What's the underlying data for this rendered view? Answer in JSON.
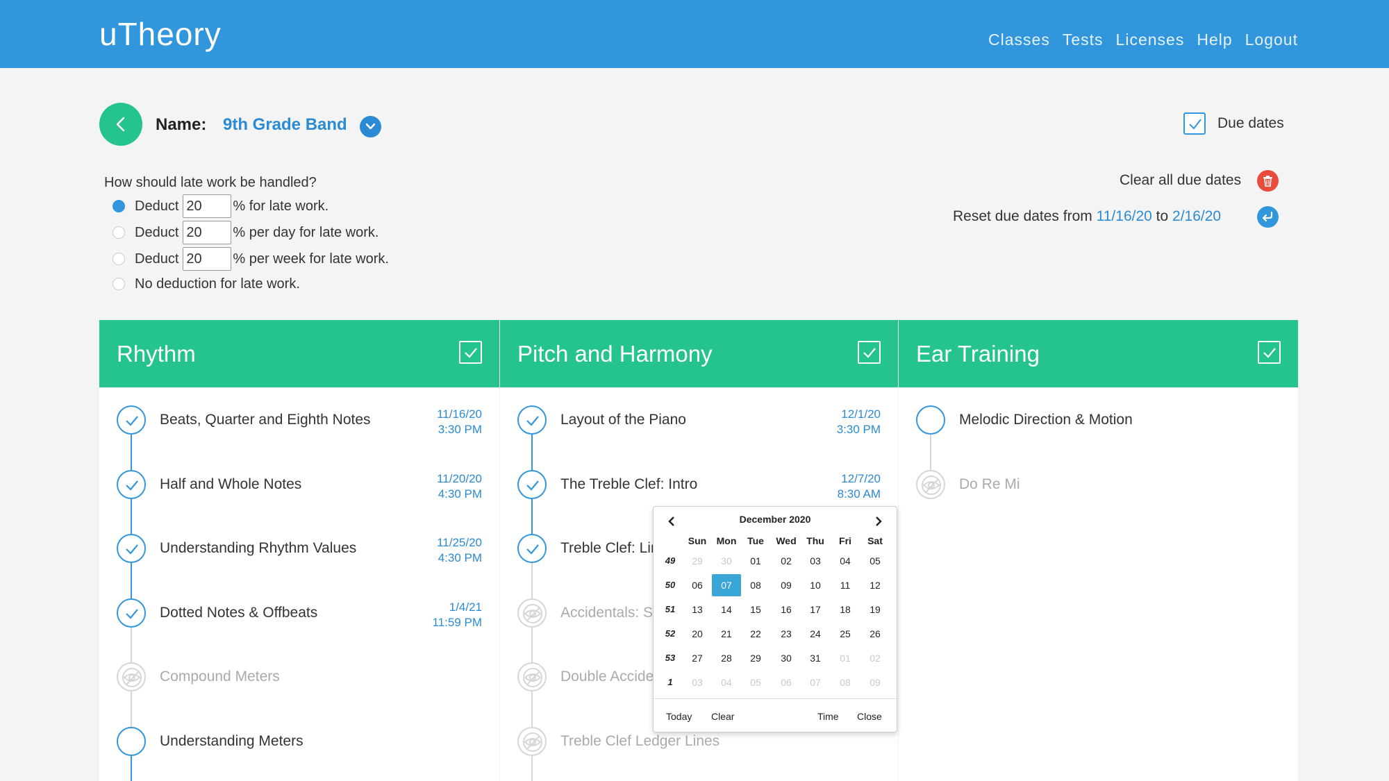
{
  "app": {
    "logo": "uTheory"
  },
  "nav": [
    "Classes",
    "Tests",
    "Licenses",
    "Help",
    "Logout"
  ],
  "header": {
    "name_label": "Name:",
    "class_name": "9th Grade Band",
    "due_dates_label": "Due dates",
    "due_dates_checked": true
  },
  "late_work": {
    "question": "How should late work be handled?",
    "options": [
      {
        "prefix": "Deduct",
        "value": "20",
        "suffix": "% for late work.",
        "selected": true
      },
      {
        "prefix": "Deduct",
        "value": "20",
        "suffix": "% per day for late work.",
        "selected": false
      },
      {
        "prefix": "Deduct",
        "value": "20",
        "suffix": "% per week for late work.",
        "selected": false
      },
      {
        "text": "No deduction for late work.",
        "selected": false
      }
    ]
  },
  "due_actions": {
    "clear_all": "Clear all due dates",
    "reset_prefix": "Reset due dates from",
    "reset_from": "11/16/20",
    "reset_to_word": "to",
    "reset_to": "2/16/20"
  },
  "columns": [
    {
      "title": "Rhythm",
      "lessons": [
        {
          "title": "Beats, Quarter and Eighth Notes",
          "state": "done",
          "due_date": "11/16/20",
          "due_time": "3:30 PM"
        },
        {
          "title": "Half and Whole Notes",
          "state": "done",
          "due_date": "11/20/20",
          "due_time": "4:30 PM"
        },
        {
          "title": "Understanding Rhythm Values",
          "state": "done",
          "due_date": "11/25/20",
          "due_time": "4:30 PM"
        },
        {
          "title": "Dotted Notes & Offbeats",
          "state": "done",
          "due_date": "1/4/21",
          "due_time": "11:59 PM"
        },
        {
          "title": "Compound Meters",
          "state": "locked"
        },
        {
          "title": "Understanding Meters",
          "state": "open"
        }
      ]
    },
    {
      "title": "Pitch and Harmony",
      "lessons": [
        {
          "title": "Layout of the Piano",
          "state": "done",
          "due_date": "12/1/20",
          "due_time": "3:30 PM"
        },
        {
          "title": "The Treble Clef: Intro",
          "state": "done",
          "due_date": "12/7/20",
          "due_time": "8:30 AM"
        },
        {
          "title": "Treble Clef: Lines & Spaces",
          "state": "done"
        },
        {
          "title": "Accidentals: Sharps & Flats",
          "state": "locked"
        },
        {
          "title": "Double Accidentals",
          "state": "locked"
        },
        {
          "title": "Treble Clef Ledger Lines",
          "state": "locked"
        }
      ]
    },
    {
      "title": "Ear Training",
      "lessons": [
        {
          "title": "Melodic Direction & Motion",
          "state": "open"
        },
        {
          "title": "Do Re Mi",
          "state": "locked"
        }
      ]
    }
  ],
  "calendar": {
    "month_label": "December 2020",
    "days_of_week": [
      "Sun",
      "Mon",
      "Tue",
      "Wed",
      "Thu",
      "Fri",
      "Sat"
    ],
    "weeks": [
      {
        "week": "49",
        "days": [
          "29",
          "30",
          "01",
          "02",
          "03",
          "04",
          "05"
        ],
        "out": [
          0,
          1
        ]
      },
      {
        "week": "50",
        "days": [
          "06",
          "07",
          "08",
          "09",
          "10",
          "11",
          "12"
        ],
        "out": []
      },
      {
        "week": "51",
        "days": [
          "13",
          "14",
          "15",
          "16",
          "17",
          "18",
          "19"
        ],
        "out": []
      },
      {
        "week": "52",
        "days": [
          "20",
          "21",
          "22",
          "23",
          "24",
          "25",
          "26"
        ],
        "out": []
      },
      {
        "week": "53",
        "days": [
          "27",
          "28",
          "29",
          "30",
          "31",
          "01",
          "02"
        ],
        "out": [
          5,
          6
        ]
      },
      {
        "week": "1",
        "days": [
          "03",
          "04",
          "05",
          "06",
          "07",
          "08",
          "09"
        ],
        "out": [
          0,
          1,
          2,
          3,
          4,
          5,
          6
        ]
      }
    ],
    "selected_day": "07",
    "footer": {
      "today": "Today",
      "clear": "Clear",
      "time": "Time",
      "close": "Close"
    }
  },
  "colors": {
    "topbar": "#3296dc",
    "accent_green": "#24c48c",
    "link_blue": "#2a8ad4",
    "danger": "#e84c3d"
  }
}
